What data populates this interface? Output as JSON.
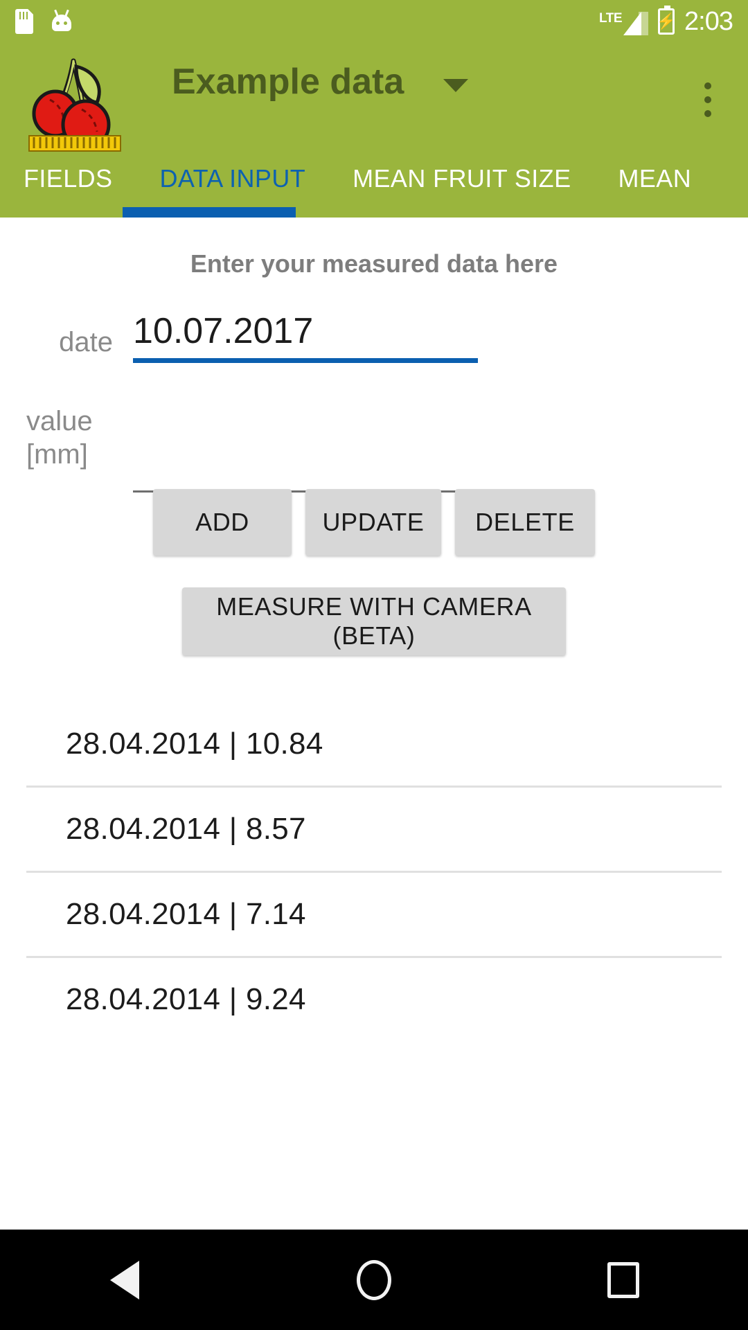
{
  "status_bar": {
    "icons": [
      "sd-card-icon",
      "android-icon",
      "lte-icon",
      "signal-icon",
      "battery-charging-icon"
    ],
    "network_label": "LTE",
    "battery_glyph": "⚡",
    "time": "2:03"
  },
  "app_bar": {
    "logo_name": "cherries-ruler-logo",
    "title": "Example data",
    "title_caret_name": "dropdown-caret-icon",
    "overflow_name": "overflow-menu-icon"
  },
  "tabs": {
    "items": [
      {
        "label": "FIELDS",
        "selected": false
      },
      {
        "label": "DATA INPUT",
        "selected": true
      },
      {
        "label": "MEAN FRUIT SIZE",
        "selected": false
      },
      {
        "label": "MEAN",
        "selected": false
      }
    ]
  },
  "main": {
    "heading": "Enter your measured data here",
    "fields": {
      "date": {
        "label": "date",
        "value": "10.07.2017",
        "placeholder": ""
      },
      "value": {
        "label": "value\n[mm]",
        "label_line1": "value",
        "label_line2": "[mm]",
        "value": "",
        "placeholder": ""
      }
    },
    "buttons": {
      "add": "ADD",
      "update": "UPDATE",
      "delete": "DELETE",
      "camera": "MEASURE WITH CAMERA (BETA)"
    },
    "list": [
      {
        "text": "28.04.2014  |  10.84",
        "date": "28.04.2014",
        "value": "10.84"
      },
      {
        "text": "28.04.2014  |  8.57",
        "date": "28.04.2014",
        "value": "8.57"
      },
      {
        "text": "28.04.2014  |  7.14",
        "date": "28.04.2014",
        "value": "7.14"
      },
      {
        "text": "28.04.2014  |  9.24",
        "date": "28.04.2014",
        "value": "9.24"
      }
    ]
  },
  "nav_bar": {
    "back": "back-button",
    "home": "home-button",
    "recents": "recents-button"
  },
  "colors": {
    "brand_green": "#9ab53d",
    "accent_blue": "#0b5fb0",
    "title_green_dark": "#4b5c1f",
    "button_gray": "#d7d7d7",
    "label_gray": "#8a8a8a"
  }
}
